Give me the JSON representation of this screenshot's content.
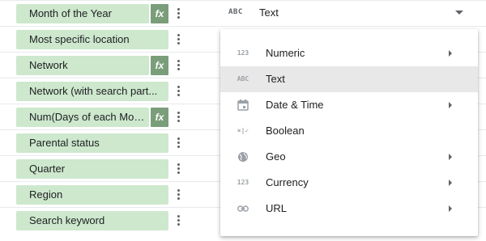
{
  "fields": [
    {
      "label": "Month of the Year",
      "fx": true
    },
    {
      "label": "Most specific location",
      "fx": false
    },
    {
      "label": "Network",
      "fx": true
    },
    {
      "label": "Network (with search part...",
      "fx": false
    },
    {
      "label": "Num(Days of each Month)",
      "fx": true
    },
    {
      "label": "Parental status",
      "fx": false
    },
    {
      "label": "Quarter",
      "fx": false
    },
    {
      "label": "Region",
      "fx": false
    },
    {
      "label": "Search keyword",
      "fx": false
    }
  ],
  "fx_label": "fx",
  "type_selector": {
    "icon_text": "ABC",
    "value": "Text"
  },
  "type_menu": {
    "selected_index": 1,
    "items": [
      {
        "label": "Numeric",
        "icon": "numeric-123-icon",
        "icon_text": "123",
        "has_submenu": true
      },
      {
        "label": "Text",
        "icon": "text-abc-icon",
        "icon_text": "ABC",
        "has_submenu": false
      },
      {
        "label": "Date & Time",
        "icon": "calendar-icon",
        "icon_text": "",
        "has_submenu": true
      },
      {
        "label": "Boolean",
        "icon": "boolean-icon",
        "icon_text": "×|✓",
        "has_submenu": false
      },
      {
        "label": "Geo",
        "icon": "globe-icon",
        "icon_text": "",
        "has_submenu": true
      },
      {
        "label": "Currency",
        "icon": "currency-123-icon",
        "icon_text": "123",
        "has_submenu": true
      },
      {
        "label": "URL",
        "icon": "link-icon",
        "icon_text": "",
        "has_submenu": true
      }
    ]
  },
  "colors": {
    "chip": "#cde8cd",
    "fx_badge": "#7a9e7a",
    "menu_selected": "#e8e8e8"
  }
}
